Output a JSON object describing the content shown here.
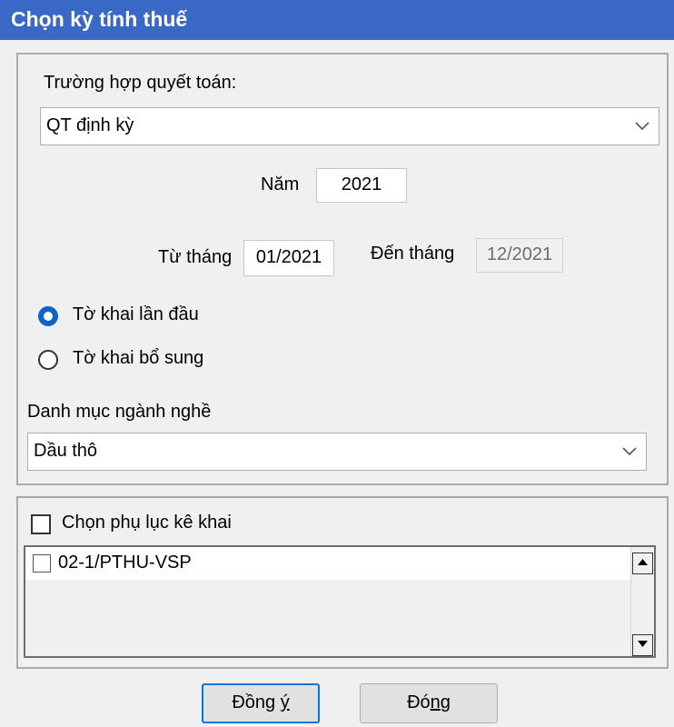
{
  "window": {
    "title": "Chọn kỳ tính thuế"
  },
  "settlement": {
    "label": "Trường hợp quyết toán:",
    "selected": "QT định kỳ"
  },
  "year": {
    "label": "Năm",
    "value": "2021"
  },
  "period": {
    "from_label": "Từ tháng",
    "from_value": "01/2021",
    "to_label": "Đến tháng",
    "to_value": "12/2021"
  },
  "declaration_type": {
    "options": [
      {
        "label": "Tờ khai lần đầu",
        "selected": true
      },
      {
        "label": "Tờ khai bổ sung",
        "selected": false
      }
    ]
  },
  "industry": {
    "label": "Danh mục ngành nghề",
    "selected": "Dầu thô"
  },
  "appendix": {
    "select_label": "Chọn phụ lục kê khai",
    "items": [
      {
        "label": "02-1/PTHU-VSP",
        "checked": false
      }
    ]
  },
  "buttons": {
    "ok": {
      "prefix": "Đồng ",
      "underlined": "ý",
      "suffix": ""
    },
    "close": {
      "prefix": "Đó",
      "underlined": "n",
      "suffix": "g"
    }
  },
  "colors": {
    "titlebar": "#3a68c6",
    "radio_selected": "#0f62c9",
    "default_button_border": "#0078d7"
  }
}
